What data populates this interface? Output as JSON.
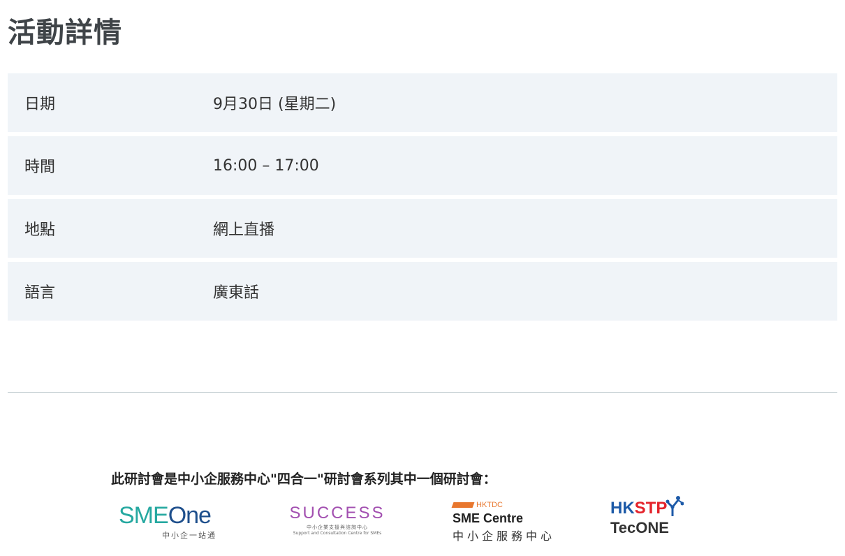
{
  "page": {
    "title": "活動詳情"
  },
  "details": [
    {
      "label": "日期",
      "value": "9月30日 (星期二)"
    },
    {
      "label": "時間",
      "value": "16:00 – 17:00"
    },
    {
      "label": "地點",
      "value": "網上直播"
    },
    {
      "label": "語言",
      "value": "廣東話"
    }
  ],
  "series": {
    "caption": "此研討會是中小企服務中心\"四合一\"研討會系列其中一個研討會："
  },
  "logos": {
    "smeone": {
      "word_a": "SME",
      "word_b": "One",
      "sub": "中小企一站通",
      "icon": "smeone-logo",
      "color": "#25a8a0"
    },
    "success": {
      "word": "SUCCESS",
      "sub_zh": "中小企業支援與諮詢中心",
      "sub_en": "Support and Consultation Centre for SMEs",
      "icon": "success-logo",
      "color": "#a24fb0"
    },
    "sme_centre": {
      "hktdc": "HKTDC",
      "en": "SME Centre",
      "zh": "中小企服務中心",
      "icon": "hktdc-sme-centre-logo",
      "color": "#e8772e"
    },
    "tecone": {
      "hk": "HK",
      "stp": "STP",
      "word": "TecONE",
      "icon": "hkstp-tecone-logo",
      "color": "#1d5aa8"
    }
  }
}
